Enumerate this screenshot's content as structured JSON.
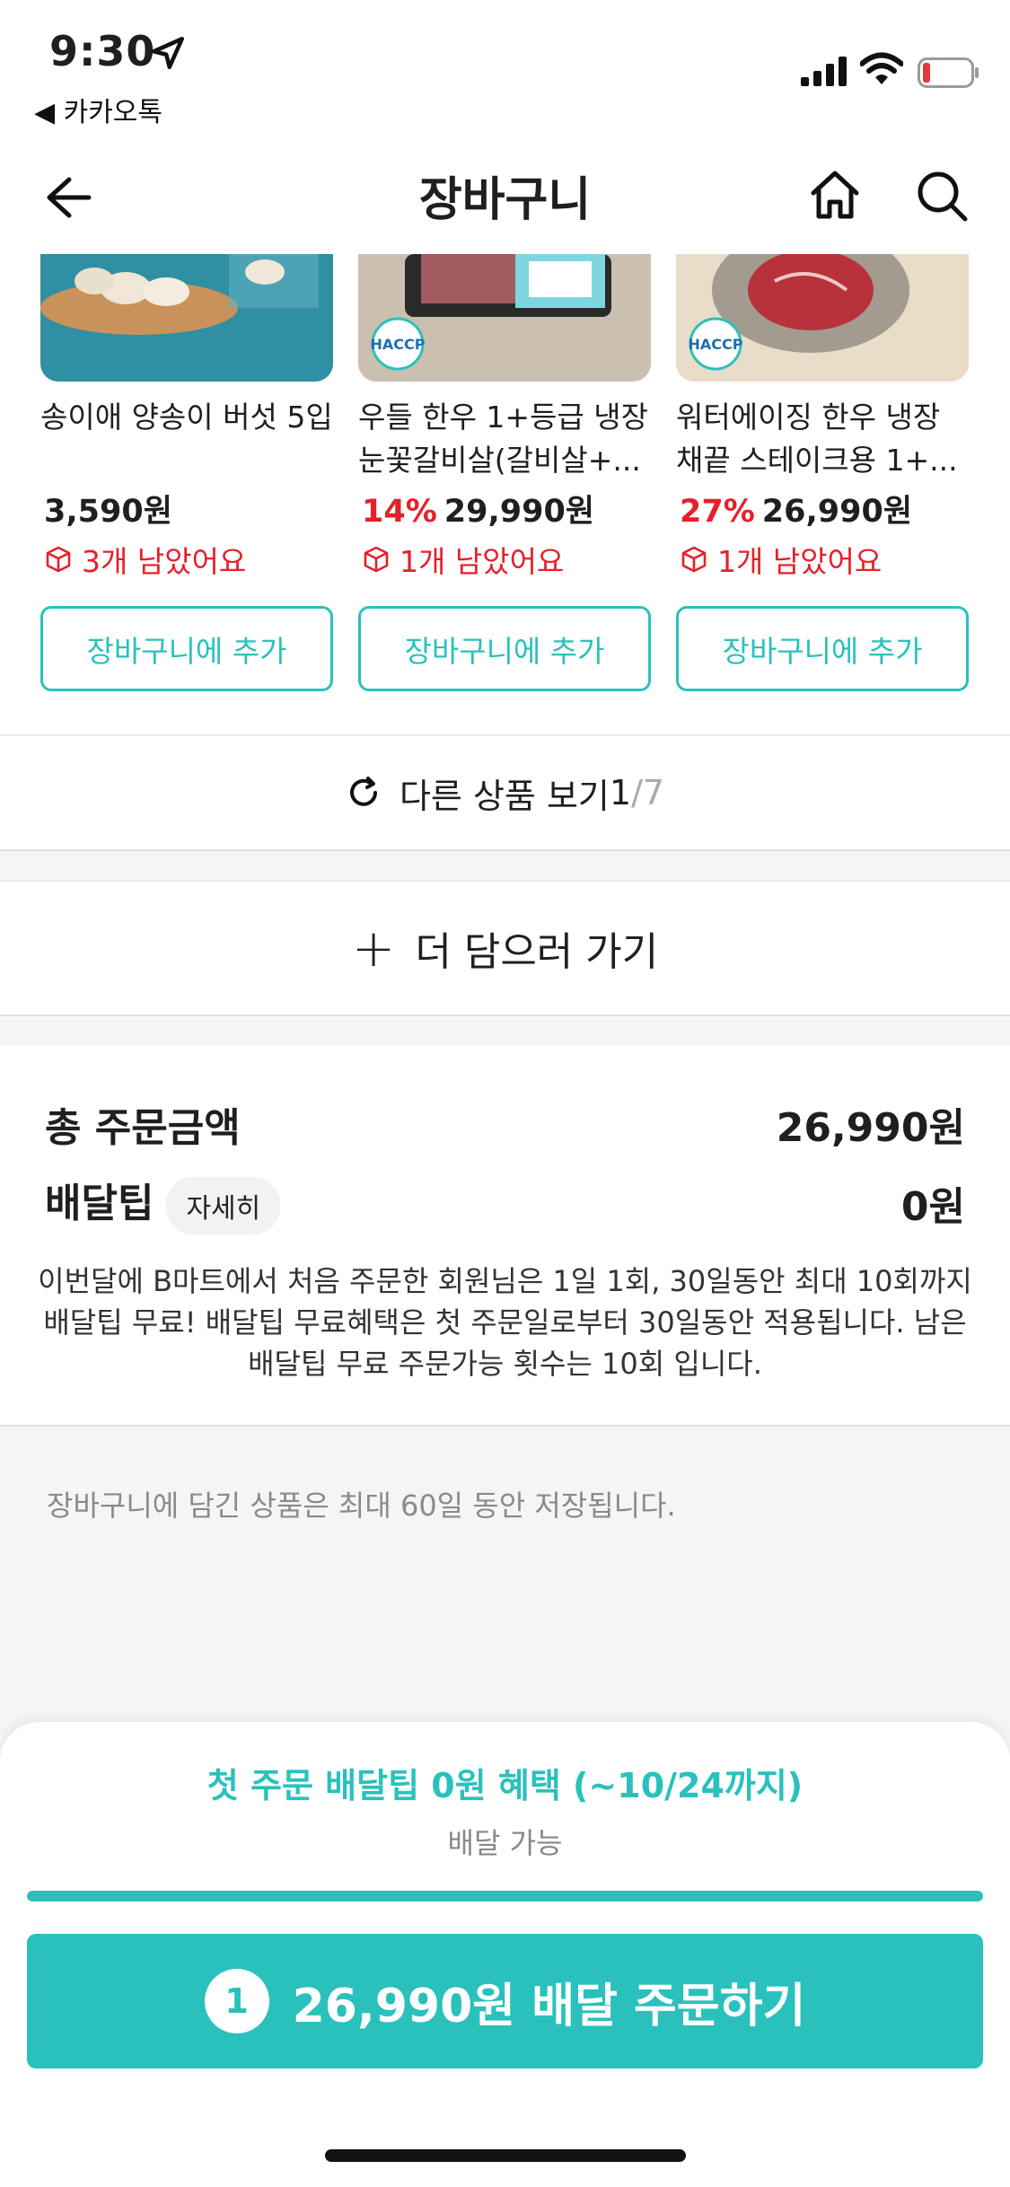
{
  "status_bar": {
    "time": "9:30",
    "back_app": "◀ 카카오톡"
  },
  "header": {
    "title": "장바구니",
    "back_icon": "arrow-left-icon",
    "home_icon": "home-icon",
    "search_icon": "search-icon"
  },
  "recommendations": [
    {
      "name": "송이애 양송이 버섯 5입",
      "discount": "",
      "price": "3,590원",
      "stock": "3개 남았어요",
      "add_label": "장바구니에 추가"
    },
    {
      "name": "우들 한우 1+등급 냉장 눈꽃갈비살(갈비살+...",
      "discount": "14%",
      "price": "29,990원",
      "stock": "1개 남았어요",
      "add_label": "장바구니에 추가",
      "badge": "HACCP"
    },
    {
      "name": "워터에이징 한우 냉장 채끝 스테이크용 1+...",
      "discount": "27%",
      "price": "26,990원",
      "stock": "1개 남았어요",
      "add_label": "장바구니에 추가",
      "badge": "HACCP"
    }
  ],
  "more_view": {
    "label": "다른 상품 보기 ",
    "page": "1",
    "total": "/7"
  },
  "add_more": {
    "label": "더 담으러 가기"
  },
  "summary": {
    "total_label": "총 주문금액",
    "total_value": "26,990원",
    "tip_label": "배달팁",
    "tip_detail": "자세히",
    "tip_value": "0원",
    "notice": "이번달에 B마트에서 처음 주문한 회원님은 1일 1회, 30일동안 최대 10회까지 배달팁 무료! 배달팁 무료혜택은 첫 주문일로부터 30일동안 적용됩니다. 남은 배달팁 무료 주문가능 횟수는 10회 입니다."
  },
  "storage_note": "장바구니에 담긴 상품은 최대 60일 동안 저장됩니다.",
  "bottom": {
    "benefit": "첫 주문 배달팁 0원 혜택 (~10/24까지)",
    "delivery_status": "배달 가능",
    "progress": 1.0,
    "order_count": "1",
    "order_label": "26,990원 배달 주문하기"
  },
  "colors": {
    "accent": "#2ac1bc",
    "discount": "#e6202a"
  }
}
